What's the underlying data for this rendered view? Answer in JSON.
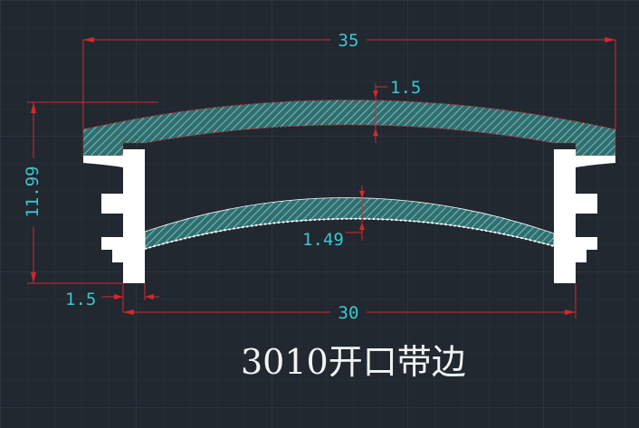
{
  "drawing": {
    "title": "3010开口带边",
    "background": "#212830",
    "grid_color": "#2e3741",
    "profile_fill": "#2f6f70",
    "profile_hatch": "#9fd9d2",
    "clip_fill": "#ffffff",
    "dimension_line_color": "#d9262a",
    "dimension_text_color": "#3ec6cf"
  },
  "dimensions": {
    "overall_width": "35",
    "opening_width": "30",
    "height": "11.99",
    "top_thickness": "1.5",
    "lens_thickness": "1.49",
    "wall_thickness": "1.5"
  }
}
